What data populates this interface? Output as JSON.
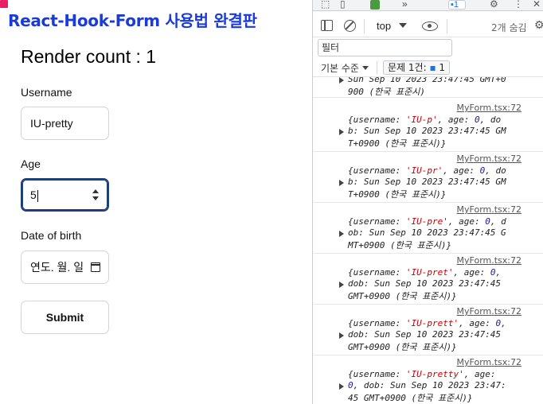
{
  "app": {
    "title": "React-Hook-Form 사용법 완결판",
    "render_count": "Render count : 1",
    "fields": {
      "username": {
        "label": "Username",
        "value": "IU-pretty"
      },
      "age": {
        "label": "Age",
        "value": "5"
      },
      "dob": {
        "label": "Date of birth",
        "placeholder": "연도. 월. 일"
      }
    },
    "submit_label": "Submit"
  },
  "devtools": {
    "issues_badge": "1",
    "context": "top",
    "hidden_count": "2개 숨김",
    "filter_placeholder": "필터",
    "levels_label": "기본 수준",
    "issues_label": "문제 1건:",
    "issues_count": "1",
    "logs": [
      {
        "source": "",
        "lines": [
          "Sun Sep 10 2023 23:47:45 GMT+0",
          "900 (한국 표준시)"
        ]
      },
      {
        "source": "MyForm.tsx:72",
        "username": "'IU-p'",
        "lines": [
          "{username: 'IU-p', age: 0, do",
          "b: Sun Sep 10 2023 23:47:45 GM",
          "T+0900 (한국 표준시)}"
        ]
      },
      {
        "source": "MyForm.tsx:72",
        "username": "'IU-pr'",
        "lines": [
          "{username: 'IU-pr', age: 0, do",
          "b: Sun Sep 10 2023 23:47:45 GM",
          "T+0900 (한국 표준시)}"
        ]
      },
      {
        "source": "MyForm.tsx:72",
        "username": "'IU-pre'",
        "lines": [
          "{username: 'IU-pre', age: 0, d",
          "ob: Sun Sep 10 2023 23:47:45 G",
          "MT+0900 (한국 표준시)}"
        ]
      },
      {
        "source": "MyForm.tsx:72",
        "username": "'IU-pret'",
        "lines": [
          "{username: 'IU-pret', age: 0,",
          "dob: Sun Sep 10 2023 23:47:45",
          "GMT+0900 (한국 표준시)}"
        ]
      },
      {
        "source": "MyForm.tsx:72",
        "username": "'IU-prett'",
        "lines": [
          "{username: 'IU-prett', age: 0,",
          "dob: Sun Sep 10 2023 23:47:45",
          "GMT+0900 (한국 표준시)}"
        ]
      },
      {
        "source": "MyForm.tsx:72",
        "username": "'IU-pretty'",
        "lines": [
          "{username: 'IU-pretty', age:",
          "0, dob: Sun Sep 10 2023 23:47:",
          "45 GMT+0900 (한국 표준시)}"
        ]
      }
    ]
  }
}
